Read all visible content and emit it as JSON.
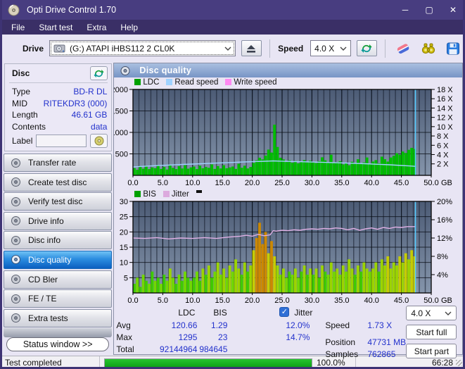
{
  "window": {
    "title": "Opti Drive Control 1.70"
  },
  "menu": {
    "items": [
      "File",
      "Start test",
      "Extra",
      "Help"
    ]
  },
  "toolbar": {
    "drive_label": "Drive",
    "drive_value": "(G:)   ATAPI iHBS112   2 CL0K",
    "speed_label": "Speed",
    "speed_value": "4.0 X"
  },
  "icons": {
    "titlebar": "disc-icon",
    "eject": "eject-icon",
    "refresh": "refresh-arrows-icon",
    "erase": "eraser-icon",
    "search": "binoculars-icon",
    "save": "floppy-save-icon",
    "nav": "disc-icon",
    "header": "disc-quality-icon"
  },
  "sidebar": {
    "disc": {
      "title": "Disc",
      "rows": [
        {
          "label": "Type",
          "value": "BD-R DL"
        },
        {
          "label": "MID",
          "value": "RITEKDR3 (000)"
        },
        {
          "label": "Length",
          "value": "46.61 GB"
        },
        {
          "label": "Contents",
          "value": "data"
        }
      ],
      "label_field": {
        "label": "Label",
        "value": ""
      }
    },
    "buttons": [
      "Transfer rate",
      "Create test disc",
      "Verify test disc",
      "Drive info",
      "Disc info",
      "Disc quality",
      "CD Bler",
      "FE / TE",
      "Extra tests"
    ],
    "selected_index": 5,
    "status_window": "Status window >>"
  },
  "main": {
    "header": "Disc quality",
    "stats": {
      "col_ldc": "LDC",
      "col_bis": "BIS",
      "jitter_label": "Jitter",
      "jitter_checked": true,
      "rows": [
        {
          "label": "Avg",
          "ldc": "120.66",
          "bis": "1.29",
          "jitter": "12.0%"
        },
        {
          "label": "Max",
          "ldc": "1295",
          "bis": "23",
          "jitter": "14.7%"
        },
        {
          "label": "Total",
          "ldc": "92144964",
          "bis": "984645",
          "jitter": ""
        }
      ],
      "speed_label": "Speed",
      "speed_value": "1.73 X",
      "position_label": "Position",
      "position_value": "47731 MB",
      "samples_label": "Samples",
      "samples_value": "762865",
      "speed_select": "4.0 X",
      "start_full": "Start full",
      "start_part": "Start part"
    }
  },
  "statusbar": {
    "text": "Test completed",
    "percent": "100.0%",
    "time": "66:28",
    "progress": 1.0
  },
  "colors": {
    "titlebar": "#483d80",
    "menubar": "#3a2f66",
    "value_blue": "#2231cc",
    "selected_button": "#1b74d0",
    "progress_green": "#12b41e",
    "plot_bg_top": "#4c5b75",
    "plot_bg_bottom": "#8595ab"
  },
  "chart_data": [
    {
      "type": "bar",
      "title": "LDC errors with read speed overlay",
      "legend": [
        {
          "label": "LDC",
          "color": "#00a000"
        },
        {
          "label": "Read speed",
          "color": "#9fd2ff"
        },
        {
          "label": "Write speed",
          "color": "#ff8af2"
        }
      ],
      "x_axis": {
        "min": 0,
        "max": 50,
        "ticks": [
          0,
          5,
          10,
          15,
          20,
          25,
          30,
          35,
          40,
          45,
          50
        ],
        "tick_labels": [
          "0.0",
          "5.0",
          "10.0",
          "15.0",
          "20.0",
          "25.0",
          "30.0",
          "35.0",
          "40.0",
          "45.0",
          "50.0"
        ],
        "unit": "GB"
      },
      "y_left": {
        "min": 0,
        "max": 2000,
        "ticks": [
          2000,
          1500,
          1000,
          500
        ]
      },
      "y_right_ticks": [
        {
          "label": "18 X",
          "pos": 2000
        },
        {
          "label": "16 X",
          "pos": 1784
        },
        {
          "label": "14 X",
          "pos": 1567
        },
        {
          "label": "12 X",
          "pos": 1350
        },
        {
          "label": "10 X",
          "pos": 1134
        },
        {
          "label": "8 X",
          "pos": 917
        },
        {
          "label": "6 X",
          "pos": 700
        },
        {
          "label": "4 X",
          "pos": 484
        },
        {
          "label": "2 X",
          "pos": 267
        }
      ],
      "bars": {
        "step_gb": 0.5,
        "palette": "solid",
        "color": "#00bd00",
        "values": [
          170,
          130,
          205,
          155,
          225,
          145,
          185,
          165,
          240,
          150,
          195,
          135,
          250,
          175,
          145,
          215,
          160,
          235,
          155,
          185,
          205,
          145,
          225,
          165,
          195,
          175,
          255,
          150,
          215,
          160,
          235,
          165,
          185,
          205,
          150,
          270,
          175,
          225,
          160,
          195,
          290,
          350,
          410,
          370,
          460,
          600,
          530,
          1180,
          660,
          410,
          370,
          310,
          350,
          295,
          335,
          280,
          320,
          355,
          300,
          340,
          310,
          285,
          330,
          420,
          350,
          290,
          480,
          285,
          310,
          330,
          255,
          295,
          235,
          315,
          275,
          375,
          260,
          300,
          415,
          280,
          320,
          355,
          280,
          435,
          375,
          320,
          415,
          455,
          515,
          480,
          555,
          520,
          595,
          640,
          615
        ]
      },
      "lines": [
        {
          "name": "read-speed",
          "color": "#9fd2ff",
          "y_mult": 1,
          "points": [
            [
              0,
              195
            ],
            [
              2,
              212
            ],
            [
              4,
              226
            ],
            [
              6,
              240
            ],
            [
              8,
              252
            ],
            [
              10,
              263
            ],
            [
              12,
              274
            ],
            [
              14,
              285
            ],
            [
              16,
              297
            ],
            [
              18,
              308
            ],
            [
              20,
              318
            ],
            [
              22,
              328
            ],
            [
              23.5,
              336
            ],
            [
              25,
              330
            ],
            [
              27,
              322
            ],
            [
              29,
              314
            ],
            [
              31,
              306
            ],
            [
              33,
              298
            ],
            [
              35,
              290
            ],
            [
              37,
              280
            ],
            [
              39,
              270
            ],
            [
              41,
              258
            ],
            [
              43,
              246
            ],
            [
              45,
              230
            ],
            [
              46.5,
              218
            ],
            [
              47.3,
              210
            ]
          ]
        }
      ],
      "end_marker": {
        "gb": 47.35,
        "color": "#58ccff"
      },
      "stats": {
        "avg": 120.66,
        "max": 1295,
        "total": 92144964
      }
    },
    {
      "type": "bar",
      "title": "BIS errors with jitter overlay",
      "legend": [
        {
          "label": "BIS",
          "color": "#00a000"
        },
        {
          "label": "Jitter",
          "color": "#dcaade"
        }
      ],
      "x_axis": {
        "min": 0,
        "max": 50,
        "ticks": [
          0,
          5,
          10,
          15,
          20,
          25,
          30,
          35,
          40,
          45,
          50
        ],
        "tick_labels": [
          "0.0",
          "5.0",
          "10.0",
          "15.0",
          "20.0",
          "25.0",
          "30.0",
          "35.0",
          "40.0",
          "45.0",
          "50.0"
        ],
        "unit": "GB"
      },
      "y_left": {
        "min": 0,
        "max": 30,
        "ticks": [
          30,
          25,
          20,
          15,
          10,
          5
        ]
      },
      "y_right_ticks": [
        {
          "label": "20%",
          "pos": 30
        },
        {
          "label": "16%",
          "pos": 24
        },
        {
          "label": "12%",
          "pos": 18
        },
        {
          "label": "8%",
          "pos": 12
        },
        {
          "label": "4%",
          "pos": 6
        }
      ],
      "bars": {
        "step_gb": 0.5,
        "palette": "severity",
        "colors": {
          "base": [
            "#3fcc00",
            "#72d800"
          ],
          "mid": "#9cd400",
          "high": "#c6cc00",
          "max": "#cc8800"
        },
        "thresholds": {
          "mid": 8,
          "high": 12,
          "max": 16
        },
        "values": [
          3,
          5,
          2,
          6,
          4,
          3,
          7,
          4,
          5,
          3,
          6,
          4,
          8,
          5,
          3,
          6,
          4,
          7,
          5,
          4,
          5,
          7,
          4,
          8,
          6,
          9,
          5,
          7,
          10,
          6,
          8,
          5,
          9,
          7,
          11,
          8,
          6,
          10,
          7,
          9,
          14,
          18,
          23,
          16,
          20,
          13,
          17,
          12,
          9,
          6,
          8,
          5,
          7,
          6,
          8,
          5,
          7,
          9,
          6,
          8,
          6,
          8,
          5,
          9,
          7,
          6,
          10,
          7,
          8,
          6,
          9,
          7,
          11,
          8,
          6,
          9,
          7,
          10,
          8,
          7,
          8,
          10,
          7,
          11,
          9,
          12,
          8,
          10,
          9,
          12,
          10,
          13,
          11,
          14,
          12
        ]
      },
      "lines": [
        {
          "name": "jitter",
          "color": "#e0b0e4",
          "y_mult": 1.5,
          "points": [
            [
              0,
              12.0
            ],
            [
              2,
              11.9
            ],
            [
              4,
              12.1
            ],
            [
              6,
              11.8
            ],
            [
              8,
              12.0
            ],
            [
              10,
              11.9
            ],
            [
              12,
              12.1
            ],
            [
              14,
              11.9
            ],
            [
              16,
              12.2
            ],
            [
              18,
              12.4
            ],
            [
              19,
              12.6
            ],
            [
              20,
              12.4
            ],
            [
              21,
              12.8
            ],
            [
              22,
              12.5
            ],
            [
              23,
              12.7
            ],
            [
              23.5,
              13.6
            ],
            [
              24,
              13.5
            ],
            [
              25,
              13.7
            ],
            [
              26,
              13.6
            ],
            [
              27,
              13.8
            ],
            [
              28,
              13.7
            ],
            [
              29,
              13.9
            ],
            [
              30,
              14.0
            ],
            [
              31,
              13.9
            ],
            [
              32,
              14.1
            ],
            [
              33,
              14.0
            ],
            [
              34,
              14.2
            ],
            [
              35,
              14.1
            ],
            [
              36,
              13.8
            ],
            [
              37,
              14.1
            ],
            [
              38,
              13.7
            ],
            [
              39,
              14.0
            ],
            [
              40,
              14.2
            ],
            [
              41,
              13.9
            ],
            [
              42,
              14.3
            ],
            [
              43,
              14.1
            ],
            [
              44,
              14.4
            ],
            [
              45,
              14.3
            ],
            [
              46,
              14.5
            ],
            [
              47.3,
              14.5
            ]
          ]
        }
      ],
      "end_marker": {
        "gb": 47.35,
        "color": "#58ccff"
      },
      "stats": {
        "avg": 1.29,
        "max": 23,
        "jitter_avg_pct": 12.0,
        "jitter_max_pct": 14.7
      }
    }
  ]
}
